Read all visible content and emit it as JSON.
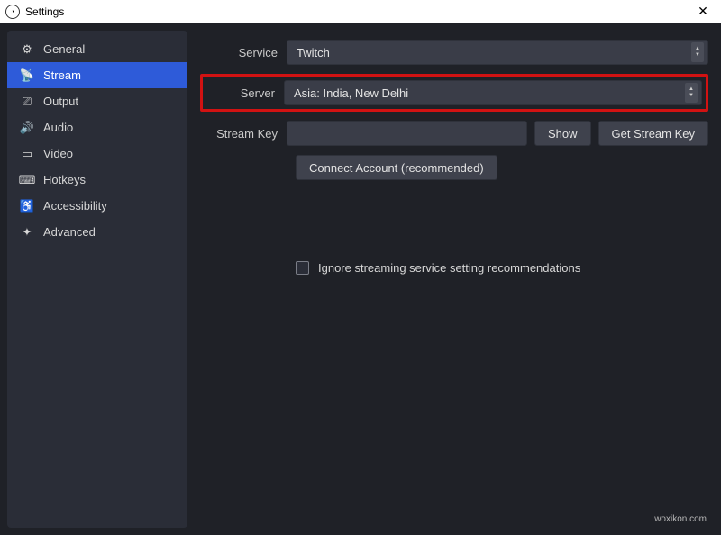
{
  "window": {
    "title": "Settings",
    "close_glyph": "✕"
  },
  "sidebar": {
    "items": [
      {
        "label": "General",
        "icon": "⚙"
      },
      {
        "label": "Stream",
        "icon": "📡"
      },
      {
        "label": "Output",
        "icon": "⎚"
      },
      {
        "label": "Audio",
        "icon": "🔊"
      },
      {
        "label": "Video",
        "icon": "▭"
      },
      {
        "label": "Hotkeys",
        "icon": "⌨"
      },
      {
        "label": "Accessibility",
        "icon": "♿"
      },
      {
        "label": "Advanced",
        "icon": "✦"
      }
    ],
    "active_index": 1
  },
  "form": {
    "service": {
      "label": "Service",
      "value": "Twitch"
    },
    "server": {
      "label": "Server",
      "value": "Asia: India, New Delhi"
    },
    "stream_key": {
      "label": "Stream Key",
      "value": ""
    },
    "buttons": {
      "show": "Show",
      "get_key": "Get Stream Key",
      "connect": "Connect Account (recommended)"
    },
    "ignore_recommendations": {
      "label": "Ignore streaming service setting recommendations",
      "checked": false
    }
  },
  "watermark": "woxikon.com"
}
